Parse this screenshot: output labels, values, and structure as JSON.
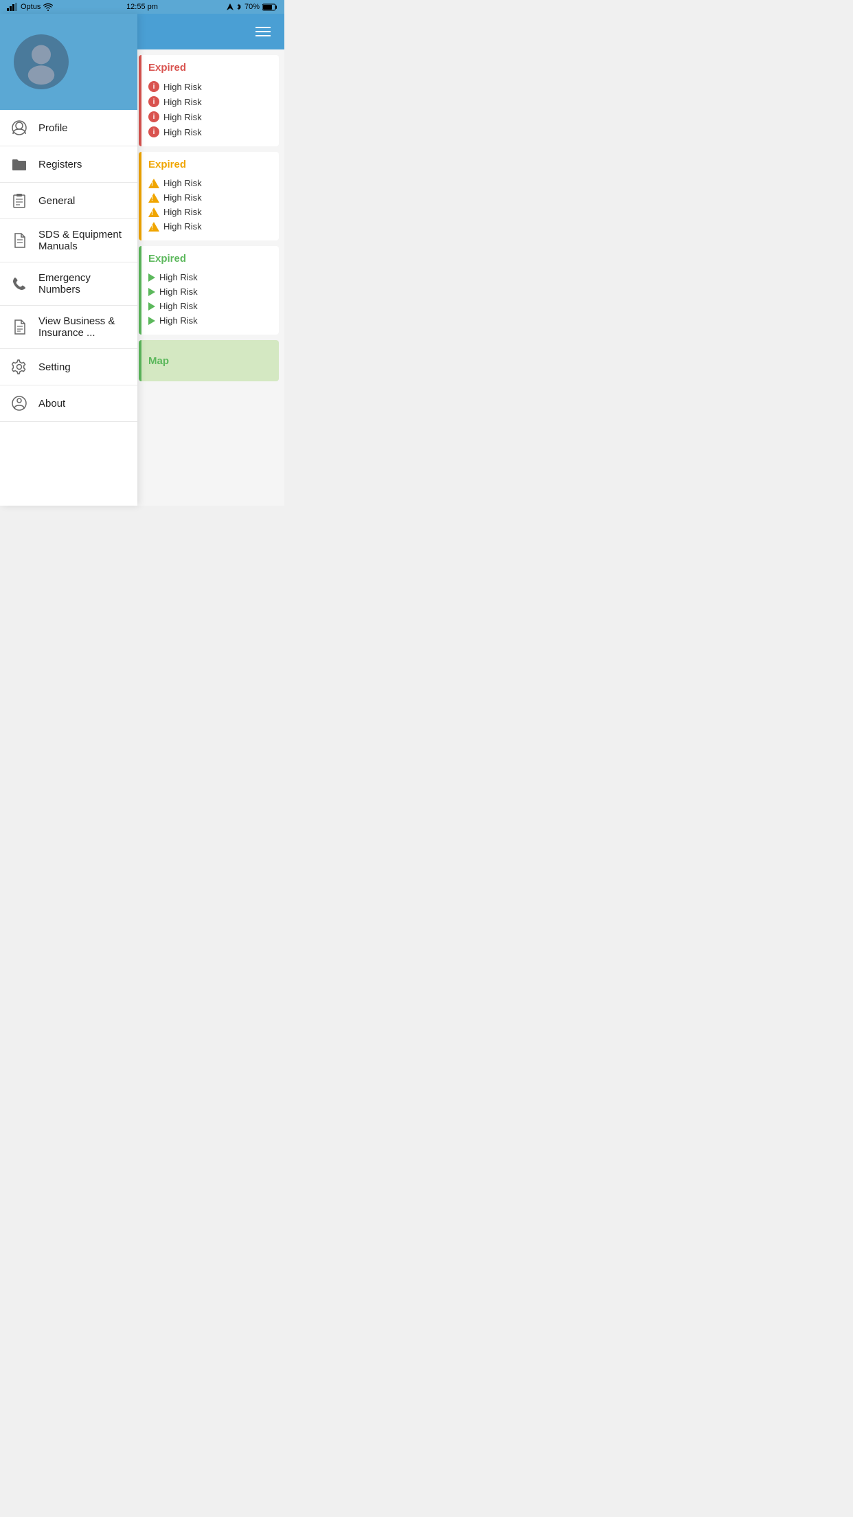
{
  "statusBar": {
    "carrier": "Optus",
    "time": "12:55 pm",
    "battery": "70%"
  },
  "sidebar": {
    "menuItems": [
      {
        "id": "profile",
        "label": "Profile",
        "icon": "person"
      },
      {
        "id": "registers",
        "label": "Registers",
        "icon": "folder"
      },
      {
        "id": "general",
        "label": "General",
        "icon": "clipboard"
      },
      {
        "id": "sds",
        "label": "SDS & Equipment Manuals",
        "icon": "document"
      },
      {
        "id": "emergency",
        "label": "Emergency Numbers",
        "icon": "phone"
      },
      {
        "id": "business",
        "label": "View Business & Insurance ...",
        "icon": "document2"
      },
      {
        "id": "setting",
        "label": "Setting",
        "icon": "gear"
      },
      {
        "id": "about",
        "label": "About",
        "icon": "person2"
      }
    ]
  },
  "rightPanel": {
    "cards": [
      {
        "id": "card-red",
        "type": "red",
        "title": "Expired",
        "iconType": "circle-info",
        "items": [
          "High Risk",
          "High Risk",
          "High Risk",
          "High Risk"
        ]
      },
      {
        "id": "card-orange",
        "type": "orange",
        "title": "Expired",
        "iconType": "triangle",
        "items": [
          "High Risk",
          "High Risk",
          "High Risk",
          "High Risk"
        ]
      },
      {
        "id": "card-green",
        "type": "green",
        "title": "Expired",
        "iconType": "play",
        "items": [
          "High Risk",
          "High Risk",
          "High Risk",
          "High Risk"
        ]
      },
      {
        "id": "card-map",
        "type": "map",
        "title": "Map"
      }
    ]
  }
}
